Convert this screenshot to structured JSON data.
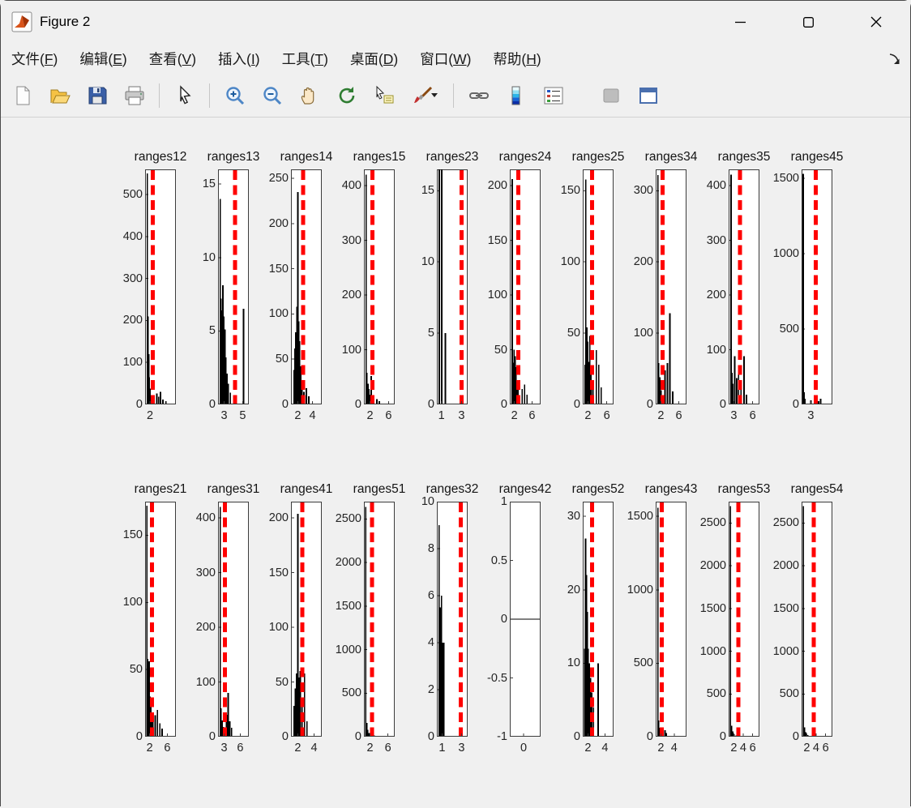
{
  "window": {
    "title": "Figure 2"
  },
  "icons": {
    "dock_arrow_glyph": "↘"
  },
  "menu": {
    "items": [
      {
        "label": "文件",
        "key": "F"
      },
      {
        "label": "编辑",
        "key": "E"
      },
      {
        "label": "查看",
        "key": "V"
      },
      {
        "label": "插入",
        "key": "I"
      },
      {
        "label": "工具",
        "key": "T"
      },
      {
        "label": "桌面",
        "key": "D"
      },
      {
        "label": "窗口",
        "key": "W"
      },
      {
        "label": "帮助",
        "key": "H"
      }
    ]
  },
  "toolbar": {
    "icons": [
      "new-figure",
      "open-file",
      "save-figure",
      "print-figure",
      "edit-plot-pointer",
      "zoom-in",
      "zoom-out",
      "pan-hand",
      "rotate-3d",
      "data-cursor",
      "brush-data",
      "link-plot",
      "insert-colorbar",
      "insert-legend",
      "hide-plot-tools",
      "show-plot-tools-dock"
    ]
  },
  "colors": {
    "red_line": "#ff0000",
    "bar": "#000000",
    "canvas_bg": "#f0f0f0"
  },
  "chart_data": [
    {
      "row": 0,
      "type": "bar",
      "title": "ranges12",
      "ylim": [
        0,
        560
      ],
      "yticks": [
        0,
        100,
        200,
        300,
        400,
        500
      ],
      "xticks": [
        {
          "label": "2",
          "pos": 0.16
        }
      ],
      "red_line": 0.25,
      "bars": [
        [
          0.07,
          550
        ],
        [
          0.1,
          210
        ],
        [
          0.12,
          120
        ],
        [
          0.14,
          65
        ],
        [
          0.16,
          38
        ],
        [
          0.18,
          22
        ],
        [
          0.38,
          26
        ],
        [
          0.44,
          18
        ],
        [
          0.5,
          30
        ],
        [
          0.58,
          12
        ],
        [
          0.68,
          8
        ]
      ]
    },
    {
      "row": 0,
      "type": "bar",
      "title": "ranges13",
      "ylim": [
        0,
        16
      ],
      "yticks": [
        0,
        5,
        10,
        15
      ],
      "xticks": [
        {
          "label": "3",
          "pos": 0.2
        },
        {
          "label": "5",
          "pos": 0.8
        }
      ],
      "red_line": 0.55,
      "bars": [
        [
          0.07,
          14
        ],
        [
          0.1,
          7.2
        ],
        [
          0.13,
          6.4
        ],
        [
          0.16,
          8.1
        ],
        [
          0.19,
          6.0
        ],
        [
          0.22,
          5.1
        ],
        [
          0.25,
          3.2
        ],
        [
          0.29,
          2.1
        ],
        [
          0.33,
          1.4
        ],
        [
          0.4,
          0.8
        ],
        [
          0.83,
          6.5
        ]
      ]
    },
    {
      "row": 0,
      "type": "bar",
      "title": "ranges14",
      "ylim": [
        0,
        260
      ],
      "yticks": [
        0,
        50,
        100,
        150,
        200,
        250
      ],
      "xticks": [
        {
          "label": "2",
          "pos": 0.22
        },
        {
          "label": "4",
          "pos": 0.7
        }
      ],
      "red_line": 0.4,
      "bars": [
        [
          0.1,
          38
        ],
        [
          0.13,
          62
        ],
        [
          0.16,
          80
        ],
        [
          0.19,
          108
        ],
        [
          0.22,
          235
        ],
        [
          0.25,
          92
        ],
        [
          0.28,
          70
        ],
        [
          0.32,
          42
        ],
        [
          0.36,
          24
        ],
        [
          0.42,
          14
        ],
        [
          0.5,
          18
        ],
        [
          0.58,
          9
        ]
      ]
    },
    {
      "row": 0,
      "type": "bar",
      "title": "ranges15",
      "ylim": [
        0,
        430
      ],
      "yticks": [
        0,
        100,
        200,
        300,
        400
      ],
      "xticks": [
        {
          "label": "2",
          "pos": 0.2
        },
        {
          "label": "6",
          "pos": 0.8
        }
      ],
      "red_line": 0.27,
      "bars": [
        [
          0.07,
          420
        ],
        [
          0.1,
          58
        ],
        [
          0.13,
          38
        ],
        [
          0.16,
          28
        ],
        [
          0.2,
          18
        ],
        [
          0.24,
          52
        ],
        [
          0.28,
          14
        ],
        [
          0.42,
          10
        ],
        [
          0.5,
          6
        ]
      ]
    },
    {
      "row": 0,
      "type": "bar",
      "title": "ranges23",
      "ylim": [
        0,
        16.5
      ],
      "yticks": [
        0,
        5,
        10,
        15
      ],
      "xticks": [
        {
          "label": "1",
          "pos": 0.15
        },
        {
          "label": "3",
          "pos": 0.8
        }
      ],
      "red_line": 0.8,
      "bars": [
        [
          0.08,
          16.5
        ],
        [
          0.16,
          16.5
        ],
        [
          0.28,
          5
        ]
      ]
    },
    {
      "row": 0,
      "type": "bar",
      "title": "ranges24",
      "ylim": [
        0,
        215
      ],
      "yticks": [
        0,
        50,
        100,
        150,
        200
      ],
      "xticks": [
        {
          "label": "2",
          "pos": 0.15
        },
        {
          "label": "6",
          "pos": 0.72
        }
      ],
      "red_line": 0.28,
      "bars": [
        [
          0.08,
          206
        ],
        [
          0.11,
          38
        ],
        [
          0.14,
          50
        ],
        [
          0.17,
          44
        ],
        [
          0.2,
          34
        ],
        [
          0.23,
          20
        ],
        [
          0.27,
          14
        ],
        [
          0.4,
          14
        ],
        [
          0.48,
          18
        ],
        [
          0.56,
          9
        ]
      ]
    },
    {
      "row": 0,
      "type": "bar",
      "title": "ranges25",
      "ylim": [
        0,
        165
      ],
      "yticks": [
        0,
        50,
        100,
        150
      ],
      "xticks": [
        {
          "label": "2",
          "pos": 0.17
        },
        {
          "label": "6",
          "pos": 0.78
        }
      ],
      "red_line": 0.3,
      "bars": [
        [
          0.07,
          28
        ],
        [
          0.1,
          158
        ],
        [
          0.13,
          54
        ],
        [
          0.16,
          44
        ],
        [
          0.19,
          30
        ],
        [
          0.23,
          48
        ],
        [
          0.27,
          24
        ],
        [
          0.33,
          16
        ],
        [
          0.44,
          38
        ],
        [
          0.52,
          28
        ],
        [
          0.6,
          12
        ]
      ]
    },
    {
      "row": 0,
      "type": "bar",
      "title": "ranges34",
      "ylim": [
        0,
        330
      ],
      "yticks": [
        0,
        100,
        200,
        300
      ],
      "xticks": [
        {
          "label": "2",
          "pos": 0.17
        },
        {
          "label": "6",
          "pos": 0.75
        }
      ],
      "red_line": 0.22,
      "bars": [
        [
          0.07,
          322
        ],
        [
          0.1,
          58
        ],
        [
          0.13,
          38
        ],
        [
          0.17,
          20
        ],
        [
          0.3,
          48
        ],
        [
          0.38,
          58
        ],
        [
          0.46,
          128
        ],
        [
          0.55,
          18
        ]
      ]
    },
    {
      "row": 0,
      "type": "bar",
      "title": "ranges35",
      "ylim": [
        0,
        430
      ],
      "yticks": [
        0,
        100,
        200,
        300,
        400
      ],
      "xticks": [
        {
          "label": "3",
          "pos": 0.17
        },
        {
          "label": "6",
          "pos": 0.78
        }
      ],
      "red_line": 0.37,
      "bars": [
        [
          0.08,
          420
        ],
        [
          0.11,
          58
        ],
        [
          0.14,
          38
        ],
        [
          0.2,
          88
        ],
        [
          0.26,
          48
        ],
        [
          0.32,
          68
        ],
        [
          0.4,
          28
        ],
        [
          0.5,
          88
        ],
        [
          0.58,
          18
        ]
      ]
    },
    {
      "row": 0,
      "type": "bar",
      "title": "ranges45",
      "ylim": [
        0,
        1560
      ],
      "yticks": [
        0,
        500,
        1000,
        1500
      ],
      "xticks": [
        {
          "label": "3",
          "pos": 0.3
        }
      ],
      "red_line": 0.46,
      "bars": [
        [
          0.05,
          1530
        ],
        [
          0.08,
          80
        ],
        [
          0.11,
          38
        ],
        [
          0.3,
          28
        ],
        [
          0.55,
          22
        ],
        [
          0.62,
          38
        ]
      ]
    },
    {
      "row": 1,
      "type": "bar",
      "title": "ranges21",
      "ylim": [
        0,
        175
      ],
      "yticks": [
        0,
        50,
        100,
        150
      ],
      "xticks": [
        {
          "label": "2",
          "pos": 0.15
        },
        {
          "label": "6",
          "pos": 0.72
        }
      ],
      "red_line": 0.22,
      "bars": [
        [
          0.06,
          172
        ],
        [
          0.085,
          58
        ],
        [
          0.11,
          45
        ],
        [
          0.135,
          56
        ],
        [
          0.16,
          30
        ],
        [
          0.185,
          24
        ],
        [
          0.21,
          18
        ],
        [
          0.25,
          12
        ],
        [
          0.33,
          16
        ],
        [
          0.4,
          20
        ],
        [
          0.48,
          10
        ],
        [
          0.55,
          6
        ]
      ]
    },
    {
      "row": 1,
      "type": "bar",
      "title": "ranges31",
      "ylim": [
        0,
        430
      ],
      "yticks": [
        0,
        100,
        200,
        300,
        400
      ],
      "xticks": [
        {
          "label": "3",
          "pos": 0.2
        },
        {
          "label": "6",
          "pos": 0.72
        }
      ],
      "red_line": 0.23,
      "bars": [
        [
          0.07,
          420
        ],
        [
          0.1,
          52
        ],
        [
          0.13,
          30
        ],
        [
          0.17,
          18
        ],
        [
          0.28,
          40
        ],
        [
          0.33,
          80
        ],
        [
          0.38,
          28
        ],
        [
          0.44,
          16
        ]
      ]
    },
    {
      "row": 1,
      "type": "bar",
      "title": "ranges41",
      "ylim": [
        0,
        215
      ],
      "yticks": [
        0,
        50,
        100,
        150,
        200
      ],
      "xticks": [
        {
          "label": "2",
          "pos": 0.22
        },
        {
          "label": "4",
          "pos": 0.75
        }
      ],
      "red_line": 0.37,
      "bars": [
        [
          0.1,
          28
        ],
        [
          0.14,
          44
        ],
        [
          0.18,
          58
        ],
        [
          0.22,
          204
        ],
        [
          0.26,
          54
        ],
        [
          0.3,
          60
        ],
        [
          0.36,
          30
        ],
        [
          0.44,
          58
        ],
        [
          0.52,
          14
        ]
      ]
    },
    {
      "row": 1,
      "type": "bar",
      "title": "ranges51",
      "ylim": [
        0,
        2700
      ],
      "yticks": [
        0,
        500,
        1000,
        1500,
        2000,
        2500
      ],
      "xticks": [
        {
          "label": "2",
          "pos": 0.2
        },
        {
          "label": "6",
          "pos": 0.78
        }
      ],
      "red_line": 0.26,
      "bars": [
        [
          0.06,
          2640
        ],
        [
          0.09,
          160
        ],
        [
          0.12,
          80
        ],
        [
          0.17,
          40
        ],
        [
          0.25,
          25
        ],
        [
          0.33,
          15
        ]
      ]
    },
    {
      "row": 1,
      "type": "bar",
      "title": "ranges32",
      "ylim": [
        0,
        10
      ],
      "yticks": [
        0,
        2,
        4,
        6,
        8,
        10
      ],
      "xticks": [
        {
          "label": "1",
          "pos": 0.17
        },
        {
          "label": "3",
          "pos": 0.8
        }
      ],
      "red_line": 0.78,
      "bars": [
        [
          0.07,
          9
        ],
        [
          0.11,
          5.5
        ],
        [
          0.15,
          6
        ],
        [
          0.19,
          4
        ],
        [
          0.23,
          4
        ]
      ]
    },
    {
      "row": 1,
      "type": "bar",
      "title": "ranges42",
      "ylim": [
        -1,
        1
      ],
      "yticks": [
        -1,
        -0.5,
        0,
        0.5,
        1
      ],
      "xticks": [
        {
          "label": "0",
          "pos": 0.45
        }
      ],
      "red_line": null,
      "zero_line": true,
      "bars": []
    },
    {
      "row": 1,
      "type": "bar",
      "title": "ranges52",
      "ylim": [
        0,
        32
      ],
      "yticks": [
        0,
        10,
        20,
        30
      ],
      "xticks": [
        {
          "label": "2",
          "pos": 0.17
        },
        {
          "label": "4",
          "pos": 0.72
        }
      ],
      "red_line": 0.3,
      "bars": [
        [
          0.06,
          12
        ],
        [
          0.09,
          27
        ],
        [
          0.12,
          22
        ],
        [
          0.15,
          17
        ],
        [
          0.18,
          12
        ],
        [
          0.21,
          10
        ],
        [
          0.25,
          8
        ],
        [
          0.29,
          6
        ],
        [
          0.35,
          4
        ],
        [
          0.5,
          10
        ]
      ]
    },
    {
      "row": 1,
      "type": "bar",
      "title": "ranges43",
      "ylim": [
        0,
        1600
      ],
      "yticks": [
        0,
        500,
        1000,
        1500
      ],
      "xticks": [
        {
          "label": "2",
          "pos": 0.17
        },
        {
          "label": "4",
          "pos": 0.6
        }
      ],
      "red_line": 0.2,
      "bars": [
        [
          0.07,
          1560
        ],
        [
          0.1,
          110
        ],
        [
          0.13,
          60
        ],
        [
          0.17,
          35
        ],
        [
          0.22,
          20
        ],
        [
          0.3,
          45
        ],
        [
          0.35,
          25
        ]
      ]
    },
    {
      "row": 1,
      "type": "bar",
      "title": "ranges53",
      "ylim": [
        0,
        2750
      ],
      "yticks": [
        0,
        500,
        1000,
        1500,
        2000,
        2500
      ],
      "xticks": [
        {
          "label": "2",
          "pos": 0.17
        },
        {
          "label": "4",
          "pos": 0.47
        },
        {
          "label": "6",
          "pos": 0.78
        }
      ],
      "red_line": 0.31,
      "bars": [
        [
          0.06,
          2700
        ],
        [
          0.09,
          130
        ],
        [
          0.13,
          60
        ],
        [
          0.18,
          30
        ],
        [
          0.25,
          15
        ]
      ]
    },
    {
      "row": 1,
      "type": "bar",
      "title": "ranges54",
      "ylim": [
        0,
        2750
      ],
      "yticks": [
        0,
        500,
        1000,
        1500,
        2000,
        2500
      ],
      "xticks": [
        {
          "label": "2",
          "pos": 0.17
        },
        {
          "label": "4",
          "pos": 0.47
        },
        {
          "label": "6",
          "pos": 0.78
        }
      ],
      "red_line": 0.4,
      "bars": [
        [
          0.06,
          2700
        ],
        [
          0.09,
          110
        ],
        [
          0.13,
          50
        ],
        [
          0.2,
          20
        ]
      ]
    }
  ]
}
